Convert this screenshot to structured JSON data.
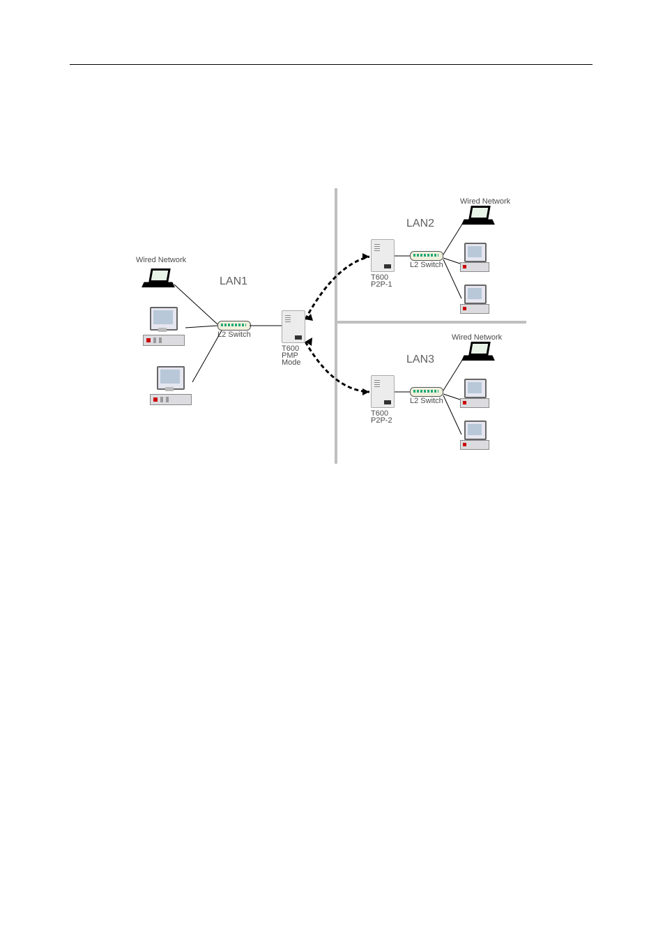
{
  "diagram": {
    "networks": {
      "lan1": {
        "title": "LAN1",
        "wired_label": "Wired Network"
      },
      "lan2": {
        "title": "LAN2",
        "wired_label": "Wired Network"
      },
      "lan3": {
        "title": "LAN3",
        "wired_label": "Wired Network"
      }
    },
    "devices": {
      "central_ap": {
        "line1": "T600",
        "line2": "PMP",
        "line3": "Mode"
      },
      "lan2_ap": {
        "line1": "T600",
        "line2": "P2P-1"
      },
      "lan3_ap": {
        "line1": "T600",
        "line2": "P2P-2"
      },
      "lan1_switch_label": "L2 Switch",
      "lan2_switch_label": "L2 Switch",
      "lan3_switch_label": "L2 Switch"
    }
  }
}
